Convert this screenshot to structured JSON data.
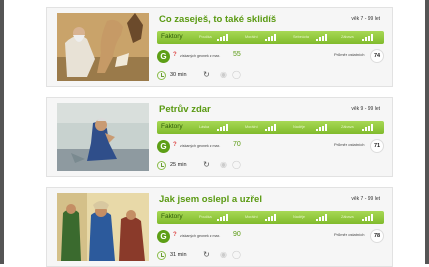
{
  "stories": [
    {
      "title": "Co zaseješ, to také sklidíš",
      "age": "věk 7 - 99 let",
      "factors_label": "Faktory",
      "factors": [
        "Poučka",
        "Morální",
        "Sebeúcta",
        "Zábava"
      ],
      "grade": "G",
      "points_text": "získaných geonek z max.",
      "points_max": "55",
      "avg_label": "Průměr ostatních",
      "avg_value": "74",
      "duration": "30 min"
    },
    {
      "title": "Petrův zdar",
      "age": "věk 9 - 99 let",
      "factors_label": "Faktory",
      "factors": [
        "Láska",
        "Morální",
        "Naděje",
        "Zábava"
      ],
      "grade": "G",
      "points_text": "získaných geonek z max.",
      "points_max": "70",
      "avg_label": "Průměr ostatních",
      "avg_value": "71",
      "duration": "25 min"
    },
    {
      "title": "Jak jsem oslepl a uzřel",
      "age": "věk 7 - 99 let",
      "factors_label": "Faktory",
      "factors": [
        "Poučka",
        "Morální",
        "Naděje",
        "Zábava"
      ],
      "grade": "G",
      "points_text": "získaných geonek z max.",
      "points_max": "90",
      "avg_label": "Průměr ostatních",
      "avg_value": "78",
      "duration": "31 min"
    }
  ],
  "colors": {
    "title_green": "#5a9a12",
    "bar_green": "#8fc63c",
    "badge_green": "#5d9f16"
  },
  "icons": [
    "clock-icon",
    "refresh-icon",
    "lock-icon",
    "info-icon"
  ]
}
